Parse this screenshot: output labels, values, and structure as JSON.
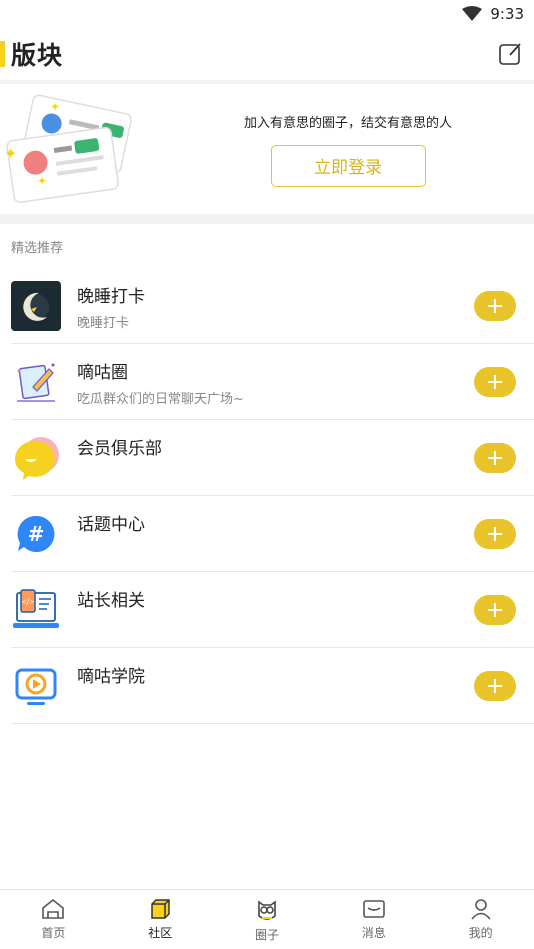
{
  "status_bar": {
    "time": "9:33"
  },
  "header": {
    "title": "版块"
  },
  "banner": {
    "text": "加入有意思的圈子，结交有意思的人",
    "login_label": "立即登录"
  },
  "section": {
    "label": "精选推荐"
  },
  "list": [
    {
      "name": "晚睡打卡",
      "desc": "晚睡打卡"
    },
    {
      "name": "嘀咕圈",
      "desc": "吃瓜群众们的日常聊天广场~"
    },
    {
      "name": "会员俱乐部",
      "desc": ""
    },
    {
      "name": "话题中心",
      "desc": ""
    },
    {
      "name": "站长相关",
      "desc": ""
    },
    {
      "name": "嘀咕学院",
      "desc": ""
    }
  ],
  "tabbar": [
    {
      "label": "首页",
      "icon": "home-icon"
    },
    {
      "label": "社区",
      "icon": "community-icon",
      "active": true
    },
    {
      "label": "圈子",
      "icon": "owl-icon"
    },
    {
      "label": "消息",
      "icon": "message-icon"
    },
    {
      "label": "我的",
      "icon": "profile-icon"
    }
  ],
  "colors": {
    "accent": "#E8C42A",
    "text": "#222222",
    "muted": "#888888"
  }
}
